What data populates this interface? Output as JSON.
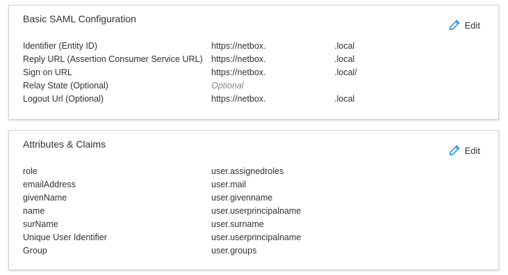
{
  "saml": {
    "title": "Basic SAML Configuration",
    "edit_label": "Edit",
    "rows": [
      {
        "label": "Identifier (Entity ID)",
        "value": "https://netbox.",
        "suffix": ".local"
      },
      {
        "label": "Reply URL (Assertion Consumer Service URL)",
        "value": "https://netbox.",
        "suffix": ".local"
      },
      {
        "label": "Sign on URL",
        "value": "https://netbox.",
        "suffix": ".local/"
      },
      {
        "label": "Relay State (Optional)",
        "value": "Optional",
        "suffix": ""
      },
      {
        "label": "Logout Url (Optional)",
        "value": "https://netbox.",
        "suffix": ".local"
      }
    ]
  },
  "claims": {
    "title": "Attributes & Claims",
    "edit_label": "Edit",
    "rows": [
      {
        "label": "role",
        "value": "user.assignedroles"
      },
      {
        "label": "emailAddress",
        "value": "user.mail"
      },
      {
        "label": "givenName",
        "value": "user.givenname"
      },
      {
        "label": "name",
        "value": "user.userprincipalname"
      },
      {
        "label": "surName",
        "value": "user.surname"
      },
      {
        "label": "Unique User Identifier",
        "value": "user.userprincipalname"
      },
      {
        "label": "Group",
        "value": "user.groups"
      }
    ]
  },
  "colors": {
    "accent": "#0078d4",
    "text": "#323130",
    "placeholder": "#8a8886",
    "border": "#d4d4d4"
  },
  "icons": {
    "edit": "pencil-icon"
  }
}
